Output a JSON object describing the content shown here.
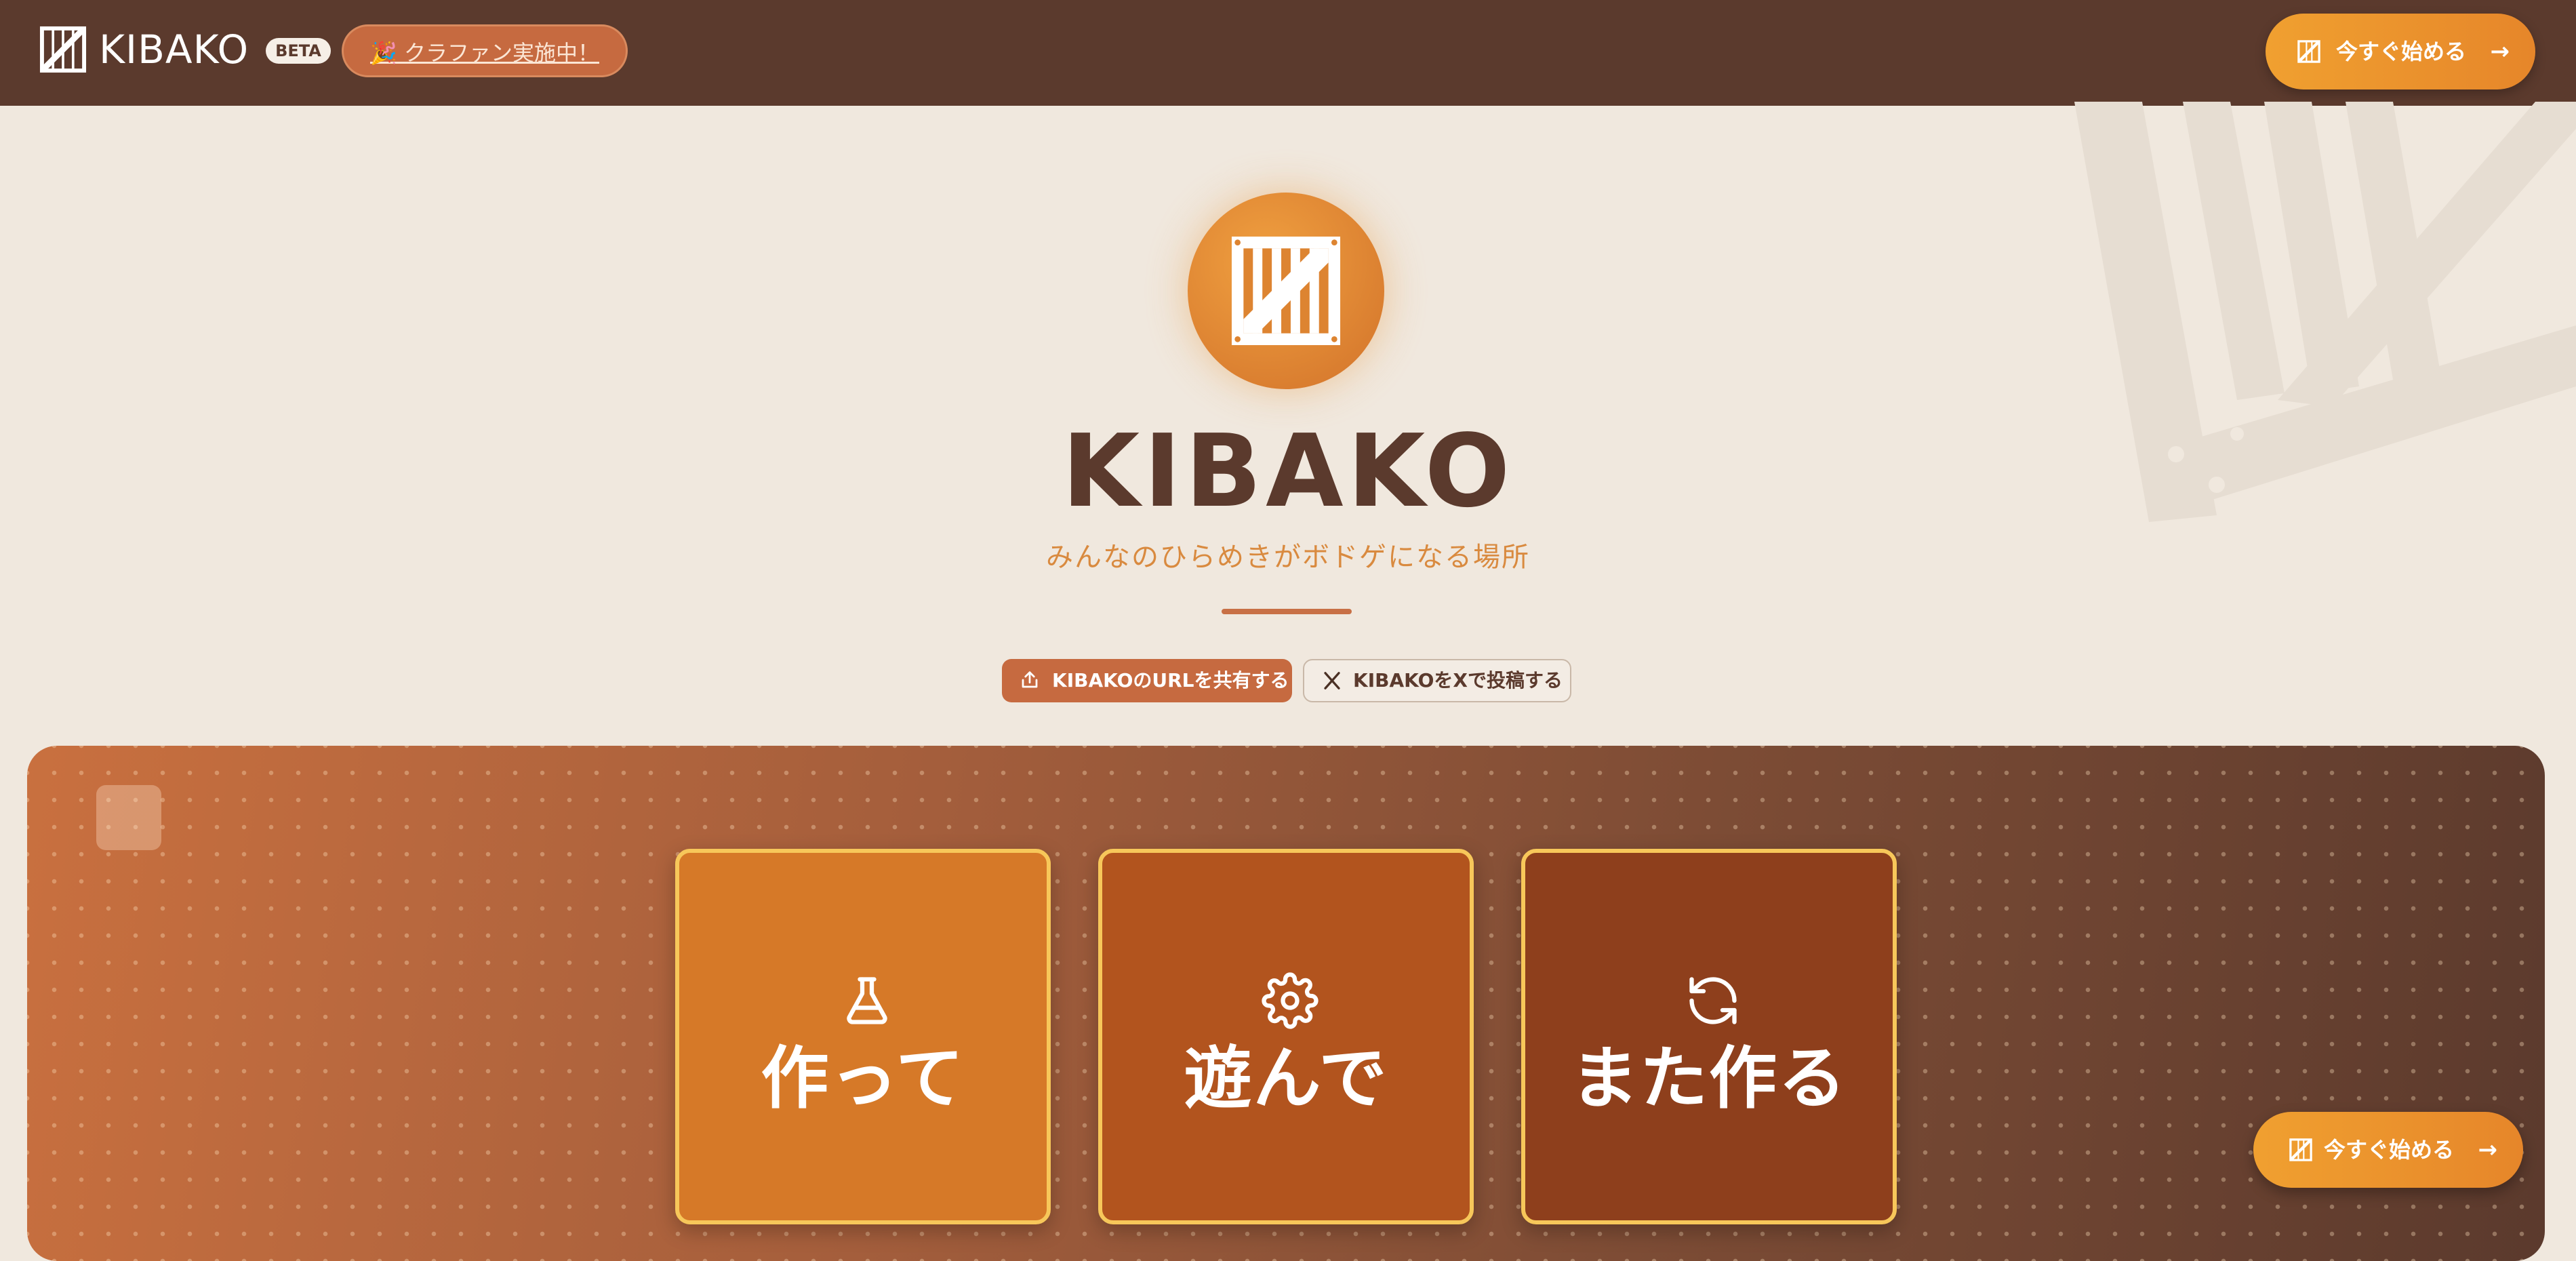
{
  "header": {
    "logo_text": "KIBAKO",
    "beta_badge": "BETA",
    "crowdfunding_button": "🎉 クラファン実施中！",
    "cta_label": "今すぐ始める",
    "cta_arrow": "→"
  },
  "hero": {
    "title": "KIBAKO",
    "tagline": "みんなのひらめきがボドゲになる場所",
    "share_url_button": "KIBAKOのURLを共有する",
    "share_x_button": "KIBAKOをXで投稿する"
  },
  "features": {
    "cards": [
      {
        "label": "作って",
        "icon": "flask-icon",
        "color": "#d67928"
      },
      {
        "label": "遊んで",
        "icon": "gear-icon",
        "color": "#b2541e"
      },
      {
        "label": "また作る",
        "icon": "refresh-icon",
        "color": "#8e3f1c"
      }
    ]
  },
  "floating_cta": {
    "label": "今すぐ始める",
    "arrow": "→"
  },
  "colors": {
    "header_bg": "#5b3a2d",
    "page_bg": "#f0e8de",
    "accent_orange": "#e6862a",
    "accent_terracotta": "#c66a40",
    "card_border": "#f7c75a"
  }
}
